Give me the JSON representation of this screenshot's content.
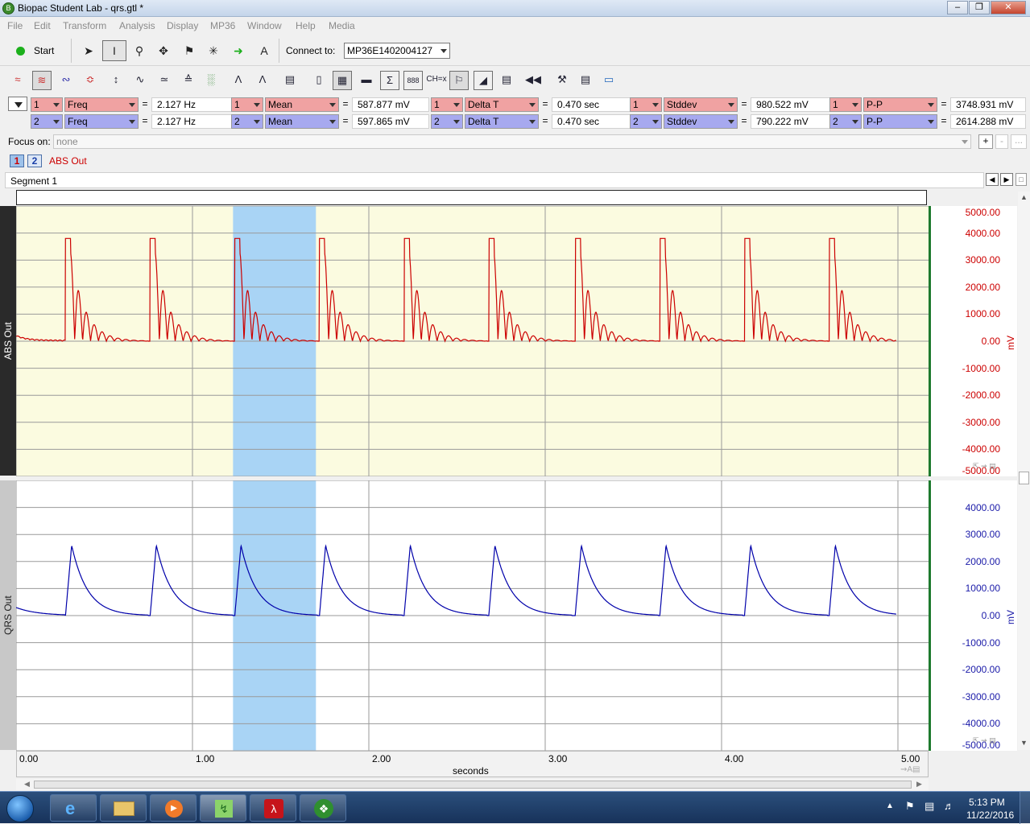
{
  "window": {
    "title": "Biopac Student Lab - qrs.gtl *"
  },
  "menu": [
    "File",
    "Edit",
    "Transform",
    "Analysis",
    "Display",
    "MP36",
    "Window",
    "Help",
    "Media"
  ],
  "toolbar": {
    "start_label": "Start",
    "connect_label": "Connect to:",
    "connect_value": "MP36E1402004127",
    "ch_label": "CH=x"
  },
  "measurements": [
    [
      {
        "ch": "1",
        "type": "Freq",
        "value": "2.127 Hz"
      },
      {
        "ch": "1",
        "type": "Mean",
        "value": "587.877 mV"
      },
      {
        "ch": "1",
        "type": "Delta T",
        "value": "0.470 sec"
      },
      {
        "ch": "1",
        "type": "Stddev",
        "value": "980.522 mV"
      },
      {
        "ch": "1",
        "type": "P-P",
        "value": "3748.931 mV"
      }
    ],
    [
      {
        "ch": "2",
        "type": "Freq",
        "value": "2.127 Hz"
      },
      {
        "ch": "2",
        "type": "Mean",
        "value": "597.865 mV"
      },
      {
        "ch": "2",
        "type": "Delta T",
        "value": "0.470 sec"
      },
      {
        "ch": "2",
        "type": "Stddev",
        "value": "790.222 mV"
      },
      {
        "ch": "2",
        "type": "P-P",
        "value": "2614.288 mV"
      }
    ]
  ],
  "focus": {
    "label": "Focus on:",
    "value": "none"
  },
  "channel_tabs": {
    "tab1": "1",
    "tab2": "2",
    "active_label": "ABS Out"
  },
  "segment": "Segment 1",
  "colors": {
    "ch1": "#cc0000",
    "ch2": "#0000aa",
    "ch1_bg": "#fbfbe0",
    "selection": "#a9d4f5"
  },
  "chart_data": [
    {
      "type": "line",
      "channel_label": "ABS Out",
      "unit": "mV",
      "ytick_labels": [
        "5000.00",
        "4000.00",
        "3000.00",
        "2000.00",
        "1000.00",
        "0.00",
        "-1000.00",
        "-2000.00",
        "-3000.00",
        "-4000.00",
        "-5000.00"
      ],
      "ylim": [
        -5000,
        5000
      ],
      "beat_times": [
        0.28,
        0.76,
        1.24,
        1.72,
        2.2,
        2.68,
        3.17,
        3.65,
        4.13,
        4.61
      ],
      "peak_value": 3800
    },
    {
      "type": "line",
      "channel_label": "QRS Out",
      "unit": "mV",
      "ytick_labels": [
        "4000.00",
        "3000.00",
        "2000.00",
        "1000.00",
        "0.00",
        "-1000.00",
        "-2000.00",
        "-3000.00",
        "-4000.00",
        "-5000.00"
      ],
      "ylim": [
        -5000,
        5000
      ],
      "beat_times": [
        0.28,
        0.76,
        1.24,
        1.72,
        2.2,
        2.68,
        3.17,
        3.65,
        4.13,
        4.61
      ],
      "peak_value": 2600
    }
  ],
  "x_axis": {
    "label": "seconds",
    "tick_labels": [
      "0.00",
      "1.00",
      "2.00",
      "3.00",
      "4.00",
      "5.00"
    ],
    "xlim": [
      0,
      5
    ],
    "selection": [
      1.23,
      1.7
    ]
  },
  "taskbar": {
    "time": "5:13 PM",
    "date": "11/22/2016"
  }
}
